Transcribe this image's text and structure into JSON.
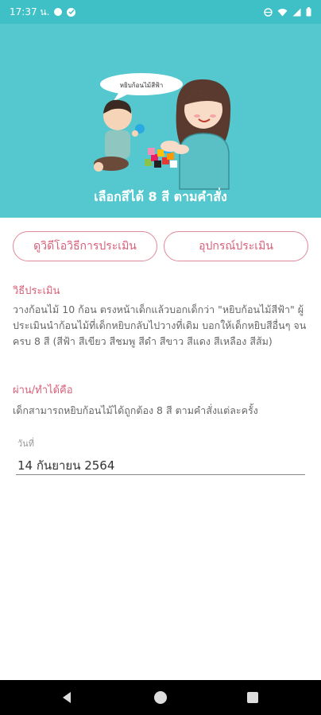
{
  "status": {
    "time": "17:37 น."
  },
  "hero": {
    "speech": "หยิบก้อนไม้สีฟ้า",
    "title": "เลือกสีได้ 8 สี ตามคำสั่ง"
  },
  "buttons": {
    "video": "ดูวิดีโอวิธีการประเมิน",
    "tools": "อุปกรณ์ประเมิน"
  },
  "method": {
    "heading": "วิธีประเมิน",
    "text": "วางก้อนไม้ 10 ก้อน ตรงหน้าเด็กแล้วบอกเด็กว่า \"หยิบก้อนไม้สีฟ้า\" ผู้ประเมินนำก้อนไม้ที่เด็กหยิบกลับไปวางที่เดิม บอกให้เด็กหยิบสีอื่นๆ จนครบ 8 สี (สีฟ้า สีเขียว สีชมพู สีดำ สีขาว สีแดง สีเหลือง สีส้ม)"
  },
  "pass": {
    "heading": "ผ่าน/ทำได้คือ",
    "text": "เด็กสามารถหยิบก้อนไม้ได้ถูกต้อง 8 สี ตามคำสั่งแต่ละครั้ง"
  },
  "date": {
    "label": "วันที่",
    "value": "14 กันยายน 2564"
  },
  "colors": {
    "header": "#55c8cf",
    "status": "#3fbfc6",
    "accent": "#d9607a"
  }
}
